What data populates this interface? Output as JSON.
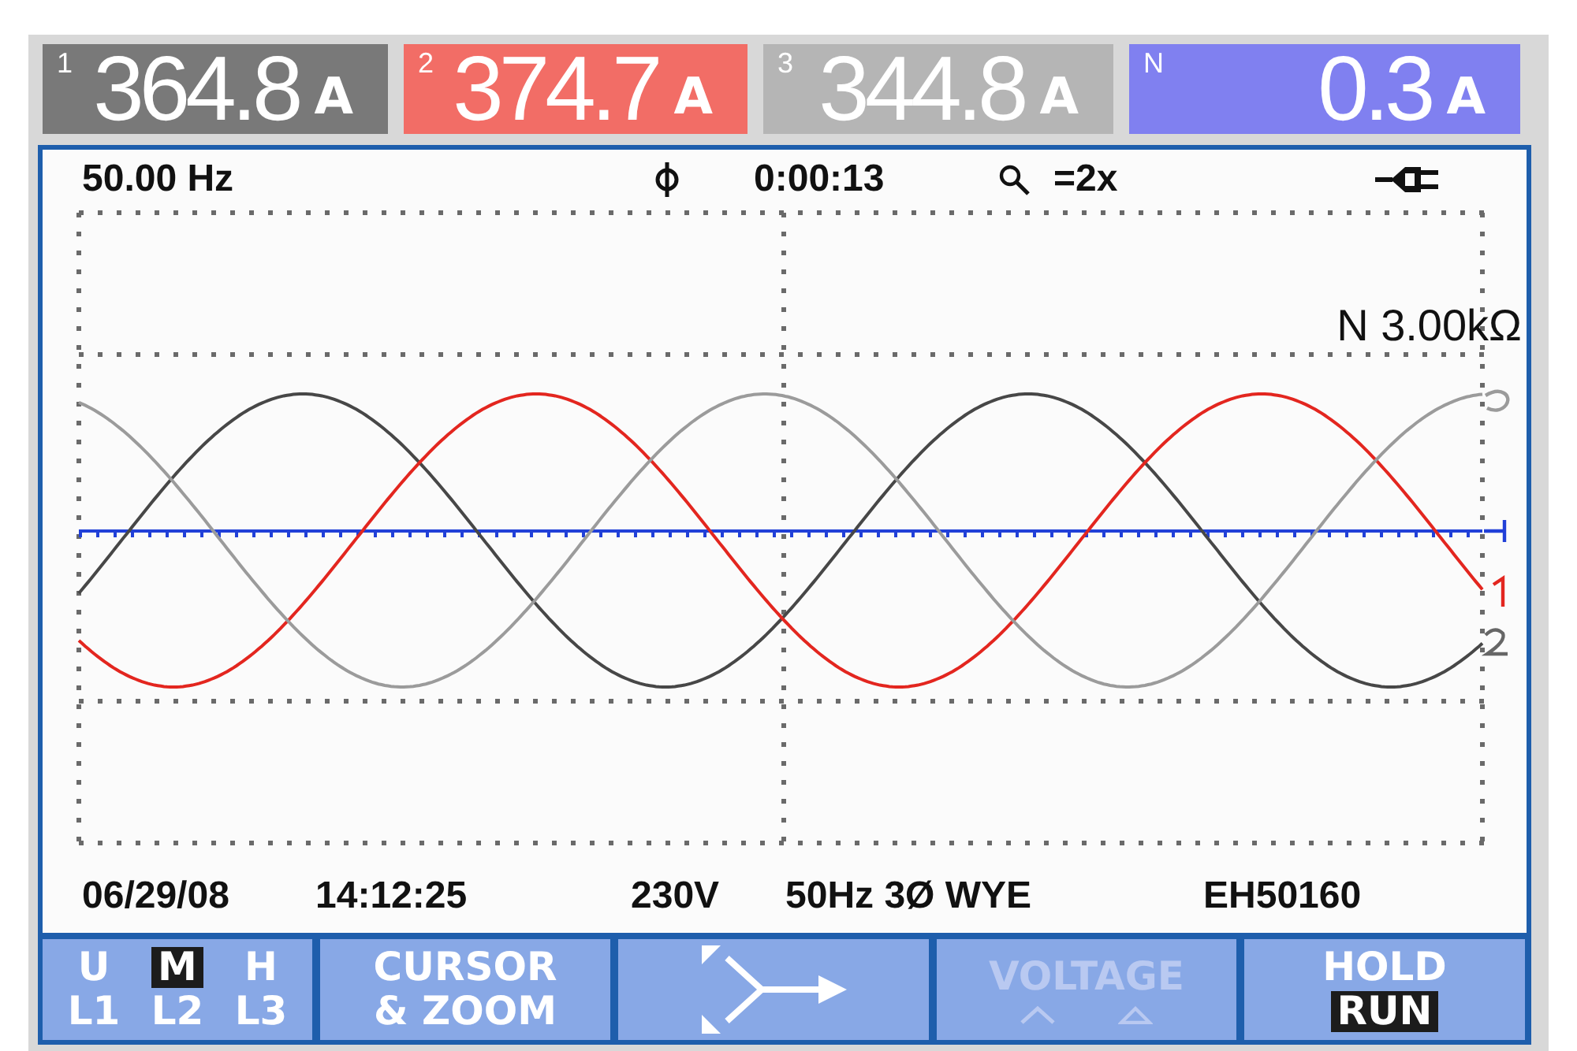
{
  "readings": [
    {
      "channel": "1",
      "value": "364.8",
      "unit": "A",
      "color": "#797979"
    },
    {
      "channel": "2",
      "value": "374.7",
      "unit": "A",
      "color": "#f26d66"
    },
    {
      "channel": "3",
      "value": "344.8",
      "unit": "A",
      "color": "#b5b5b5"
    },
    {
      "channel": "N",
      "value": "0.3",
      "unit": "A",
      "color": "#8080f0"
    }
  ],
  "top_status": {
    "frequency": "50.00 Hz",
    "elapsed": "0:00:13",
    "zoom": "=2x"
  },
  "scope": {
    "scale_label": "N 3.00kΩ"
  },
  "bottom_status": {
    "date": "06/29/08",
    "time": "14:12:25",
    "nominal_voltage": "230V",
    "configuration": "50Hz 3Ø WYE",
    "serial": "EH50160"
  },
  "softkeys": [
    {
      "kind": "options",
      "disabled": false,
      "rows": [
        [
          {
            "label": "U",
            "selected": false
          },
          {
            "label": "M",
            "selected": true
          },
          {
            "label": "H",
            "selected": false
          }
        ],
        [
          {
            "label": "L1",
            "selected": false
          },
          {
            "label": "L2",
            "selected": false
          },
          {
            "label": "L3",
            "selected": false
          }
        ]
      ]
    },
    {
      "kind": "label",
      "disabled": false,
      "lines": [
        "CURSOR",
        "& ZOOM"
      ]
    },
    {
      "kind": "icon",
      "disabled": false
    },
    {
      "kind": "stepper",
      "disabled": true,
      "lines": [
        "VOLTAGE"
      ]
    },
    {
      "kind": "options",
      "disabled": false,
      "rows": [
        [
          {
            "label": "HOLD",
            "selected": false
          }
        ],
        [
          {
            "label": "RUN",
            "selected": true
          }
        ]
      ]
    }
  ]
}
